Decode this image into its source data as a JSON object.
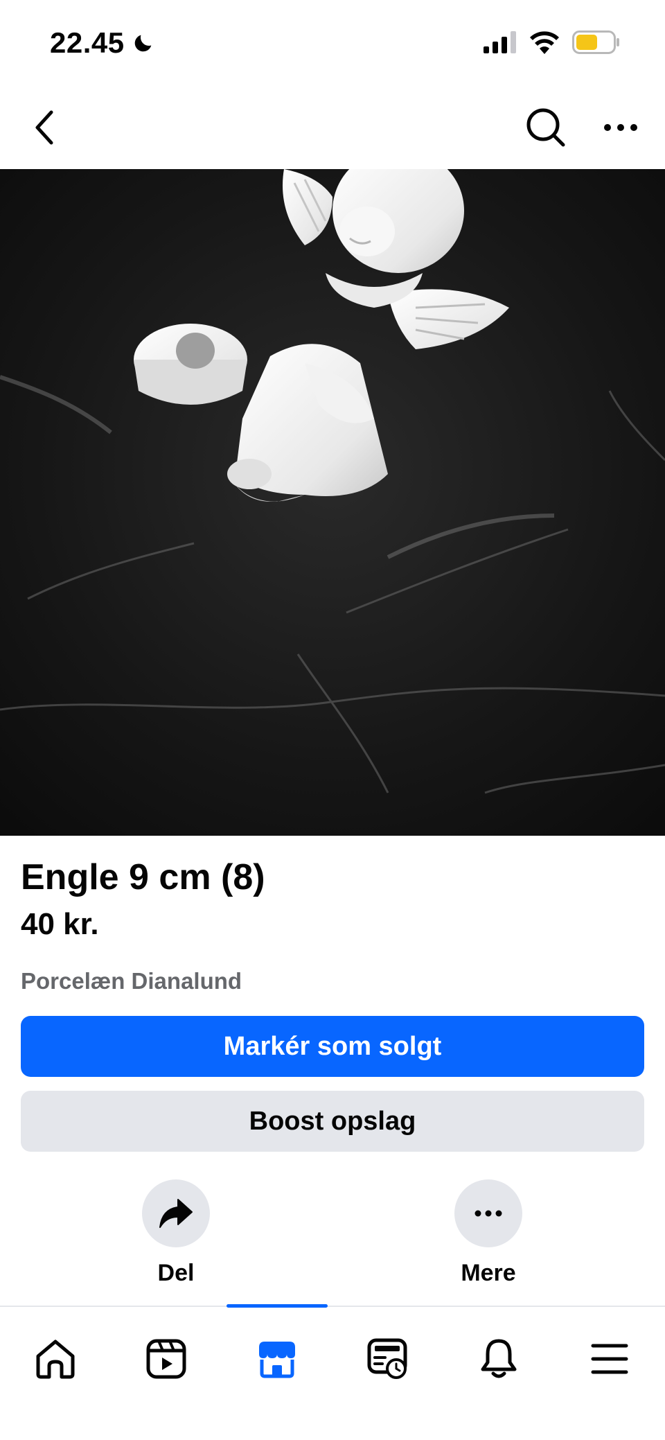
{
  "status_bar": {
    "time": "22.45",
    "icons": [
      "moon-icon",
      "signal-icon",
      "wifi-icon",
      "battery-icon"
    ]
  },
  "nav": {
    "icons": [
      "back-icon",
      "search-icon",
      "more-icon"
    ]
  },
  "listing": {
    "title": "Engle 9 cm (8)",
    "price": "40 kr.",
    "location": "Porcelæn Dianalund"
  },
  "buttons": {
    "mark_sold": "Markér som solgt",
    "boost": "Boost opslag"
  },
  "actions": {
    "share_label": "Del",
    "more_label": "Mere"
  },
  "tab_bar": {
    "active": "marketplace",
    "icons": [
      "home-icon",
      "video-icon",
      "marketplace-icon",
      "feeds-icon",
      "bell-icon",
      "menu-icon"
    ]
  },
  "colors": {
    "accent": "#0866ff",
    "secondary_button": "#e4e6eb",
    "muted_text": "#65676b",
    "battery": "#f5c518"
  }
}
